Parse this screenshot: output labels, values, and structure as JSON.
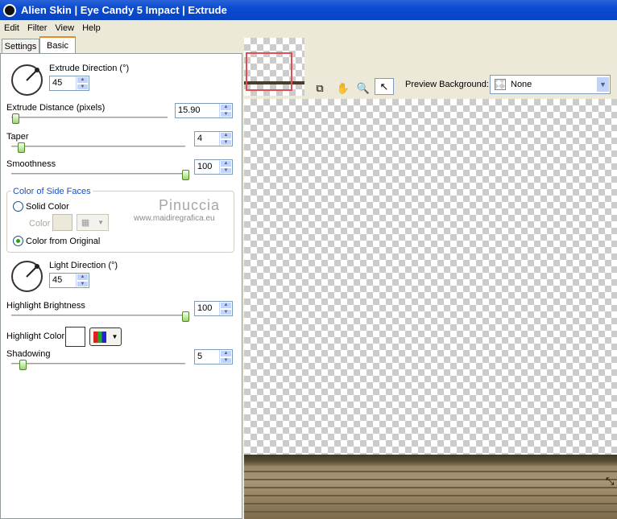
{
  "window": {
    "title": "Alien Skin | Eye Candy 5 Impact | Extrude"
  },
  "menu": [
    "Edit",
    "Filter",
    "View",
    "Help"
  ],
  "tabs": [
    "Settings",
    "Basic"
  ],
  "extrude_direction": {
    "label": "Extrude Direction (°)",
    "value": "45"
  },
  "extrude_distance": {
    "label": "Extrude Distance (pixels)",
    "value": "15.90",
    "level": 0.02
  },
  "taper": {
    "label": "Taper",
    "value": "4",
    "level": 0.06
  },
  "smoothness": {
    "label": "Smoothness",
    "value": "100",
    "level": 1.0
  },
  "side_faces": {
    "group_label": "Color of Side Faces",
    "solid_color": "Solid Color",
    "color_label": "Color",
    "from_original": "Color from Original",
    "selected": "from_original"
  },
  "watermark": {
    "name": "Pinuccia",
    "url": "www.maidiregrafica.eu"
  },
  "light_direction": {
    "label": "Light Direction (°)",
    "value": "45"
  },
  "highlight_brightness": {
    "label": "Highlight Brightness",
    "value": "100",
    "level": 1.0
  },
  "highlight_color": {
    "label": "Highlight Color",
    "swatch": "#ffffff"
  },
  "shadowing": {
    "label": "Shadowing",
    "value": "5",
    "level": 0.06
  },
  "preview": {
    "bg_label": "Preview Background:",
    "bg_value": "None"
  },
  "icons": [
    "eye-candy-logo-icon",
    "preview-toggle-icon",
    "hand-pan-icon",
    "zoom-icon",
    "pointer-icon",
    "color-palette-icon",
    "chevron-down-icon"
  ]
}
